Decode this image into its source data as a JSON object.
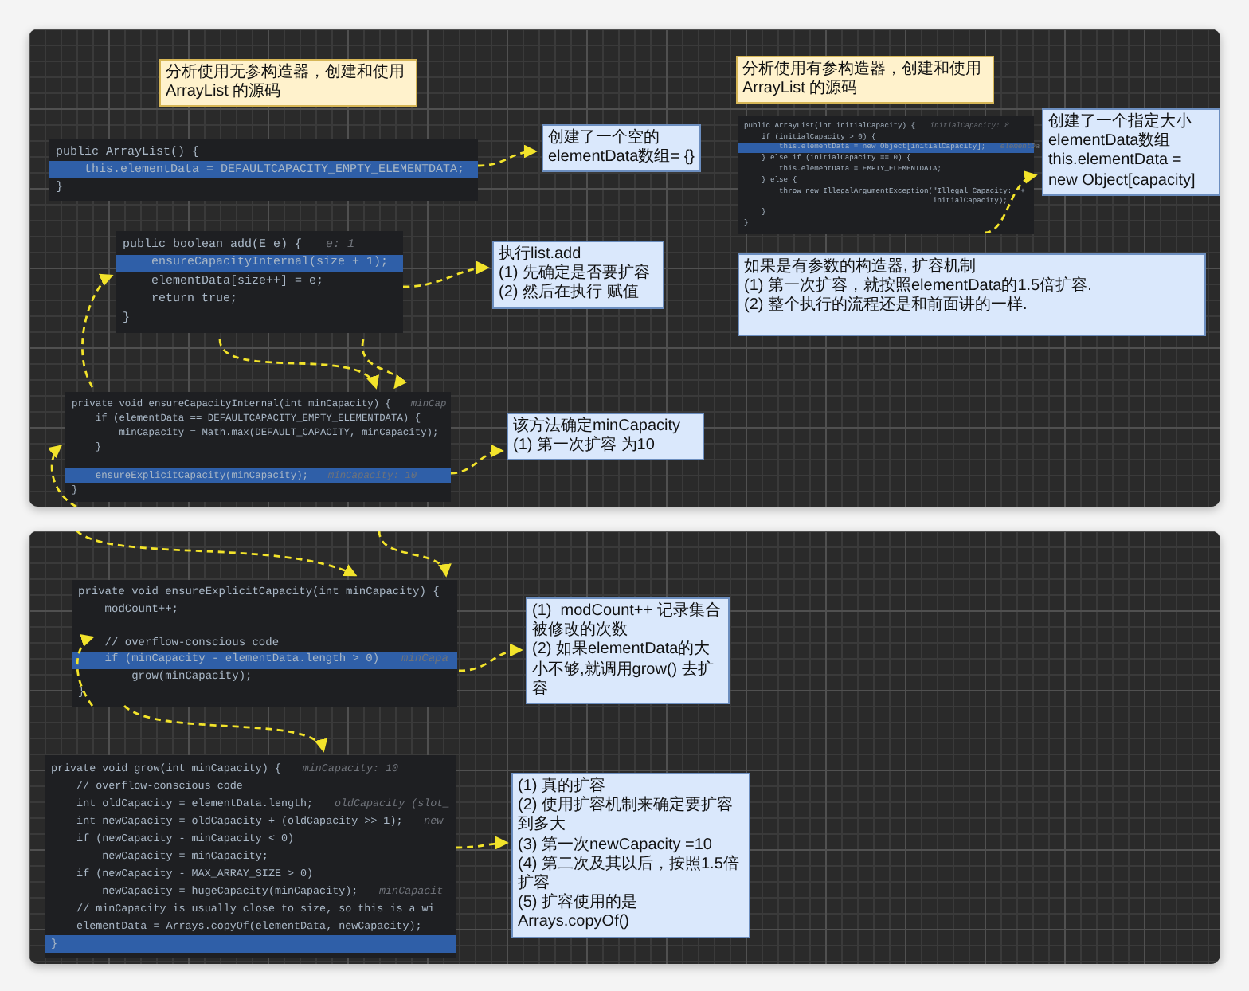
{
  "panels": [
    {
      "notes": [
        {
          "kind": "title",
          "text": "分析使用无参构造器，创建和使用 ArrayList 的源码"
        },
        {
          "kind": "note",
          "text": "创建了一个空的elementData数组= {}"
        },
        {
          "kind": "note",
          "text": "执行list.add\n(1) 先确定是否要扩容\n(2) 然后在执行 赋值"
        },
        {
          "kind": "note",
          "text": "该方法确定minCapacity\n(1) 第一次扩容 为10"
        },
        {
          "kind": "title",
          "text": "分析使用有参构造器，创建和使用 ArrayList 的源码"
        },
        {
          "kind": "note",
          "text": "创建了一个指定大小\nelementData数组\nthis.elementData = new Object[capacity]"
        },
        {
          "kind": "note",
          "text": "如果是有参数的构造器, 扩容机制\n(1) 第一次扩容，就按照elementData的1.5倍扩容.\n(2) 整个执行的流程还是和前面讲的一样."
        }
      ],
      "code_blocks": [
        {
          "lines": [
            {
              "kind": "code",
              "code": "public ArrayList() {",
              "selected": false
            },
            {
              "kind": "code",
              "code": "    this.elementData = DEFAULTCAPACITY_EMPTY_ELEMENTDATA;",
              "selected": true
            },
            {
              "kind": "code",
              "code": "}",
              "selected": false
            }
          ]
        },
        {
          "lines": [
            {
              "kind": "code",
              "code": "public boolean add(E e) {",
              "hint": "e: 1",
              "selected": false
            },
            {
              "kind": "code",
              "code": "    ensureCapacityInternal(size + 1);",
              "selected": true
            },
            {
              "kind": "code",
              "code": "    elementData[size++] = e;",
              "selected": false
            },
            {
              "kind": "code",
              "code": "    return true;",
              "selected": false
            },
            {
              "kind": "code",
              "code": "}",
              "selected": false
            }
          ]
        },
        {
          "lines": [
            {
              "kind": "code",
              "code": "private void ensureCapacityInternal(int minCapacity) {",
              "hint": "minCap",
              "selected": false
            },
            {
              "kind": "code",
              "code": "    if (elementData == DEFAULTCAPACITY_EMPTY_ELEMENTDATA) {",
              "selected": false
            },
            {
              "kind": "code",
              "code": "        minCapacity = Math.max(DEFAULT_CAPACITY, minCapacity);",
              "selected": false
            },
            {
              "kind": "code",
              "code": "    }",
              "selected": false
            },
            {
              "kind": "blank",
              "selected": false
            },
            {
              "kind": "code",
              "code": "    ensureExplicitCapacity(minCapacity);",
              "hint": "minCapacity: 10",
              "selected": true
            },
            {
              "kind": "code",
              "code": "}",
              "selected": false
            }
          ]
        },
        {
          "lines": [
            {
              "kind": "code",
              "code": "public ArrayList(int initialCapacity) {",
              "hint": "initialCapacity: 8",
              "selected": false
            },
            {
              "kind": "code",
              "code": "    if (initialCapacity > 0) {",
              "selected": false
            },
            {
              "kind": "code",
              "code": "        this.elementData = new Object[initialCapacity];",
              "hint": "elementDa",
              "selected": true
            },
            {
              "kind": "code",
              "code": "    } else if (initialCapacity == 0) {",
              "selected": false
            },
            {
              "kind": "code",
              "code": "        this.elementData = EMPTY_ELEMENTDATA;",
              "selected": false
            },
            {
              "kind": "code",
              "code": "    } else {",
              "selected": false
            },
            {
              "kind": "code",
              "code": "        throw new IllegalArgumentException(\"Illegal Capacity: \"+",
              "selected": false
            },
            {
              "kind": "code",
              "code": "                                           initialCapacity);",
              "selected": false
            },
            {
              "kind": "code",
              "code": "    }",
              "selected": false
            },
            {
              "kind": "code",
              "code": "}",
              "selected": false
            }
          ]
        }
      ]
    },
    {
      "notes": [
        {
          "kind": "note",
          "text": "(1)  modCount++ 记录集合被修改的次数\n(2) 如果elementData的大小不够,就调用grow() 去扩容"
        },
        {
          "kind": "note",
          "text": "(1) 真的扩容\n(2) 使用扩容机制来确定要扩容到多大\n(3) 第一次newCapacity =10\n(4) 第二次及其以后，按照1.5倍扩容\n(5) 扩容使用的是\nArrays.copyOf()"
        }
      ],
      "code_blocks": [
        {
          "lines": [
            {
              "kind": "code",
              "code": "private void ensureExplicitCapacity(int minCapacity) {",
              "selected": false
            },
            {
              "kind": "code",
              "code": "    modCount++;",
              "selected": false
            },
            {
              "kind": "blank",
              "selected": false
            },
            {
              "kind": "code",
              "code": "    // overflow-conscious code",
              "selected": false
            },
            {
              "kind": "code",
              "code": "    if (minCapacity - elementData.length > 0)",
              "hint": "minCapa",
              "selected": true
            },
            {
              "kind": "code",
              "code": "        grow(minCapacity);",
              "selected": false
            },
            {
              "kind": "code",
              "code": "}",
              "selected": false
            }
          ]
        },
        {
          "lines": [
            {
              "kind": "code",
              "code": "private void grow(int minCapacity) {",
              "hint": "minCapacity: 10",
              "selected": false
            },
            {
              "kind": "code",
              "code": "    // overflow-conscious code",
              "selected": false
            },
            {
              "kind": "code",
              "code": "    int oldCapacity = elementData.length;",
              "hint": "oldCapacity (slot_",
              "selected": false
            },
            {
              "kind": "code",
              "code": "    int newCapacity = oldCapacity + (oldCapacity >> 1);",
              "hint": "new",
              "selected": false
            },
            {
              "kind": "code",
              "code": "    if (newCapacity - minCapacity < 0)",
              "selected": false
            },
            {
              "kind": "code",
              "code": "        newCapacity = minCapacity;",
              "selected": false
            },
            {
              "kind": "code",
              "code": "    if (newCapacity - MAX_ARRAY_SIZE > 0)",
              "selected": false
            },
            {
              "kind": "code",
              "code": "        newCapacity = hugeCapacity(minCapacity);",
              "hint": "minCapacit",
              "selected": false
            },
            {
              "kind": "code",
              "code": "    // minCapacity is usually close to size, so this is a wi",
              "selected": false
            },
            {
              "kind": "code",
              "code": "    elementData = Arrays.copyOf(elementData, newCapacity);",
              "selected": false
            },
            {
              "kind": "code",
              "code": "}",
              "selected": true
            }
          ]
        }
      ]
    }
  ]
}
